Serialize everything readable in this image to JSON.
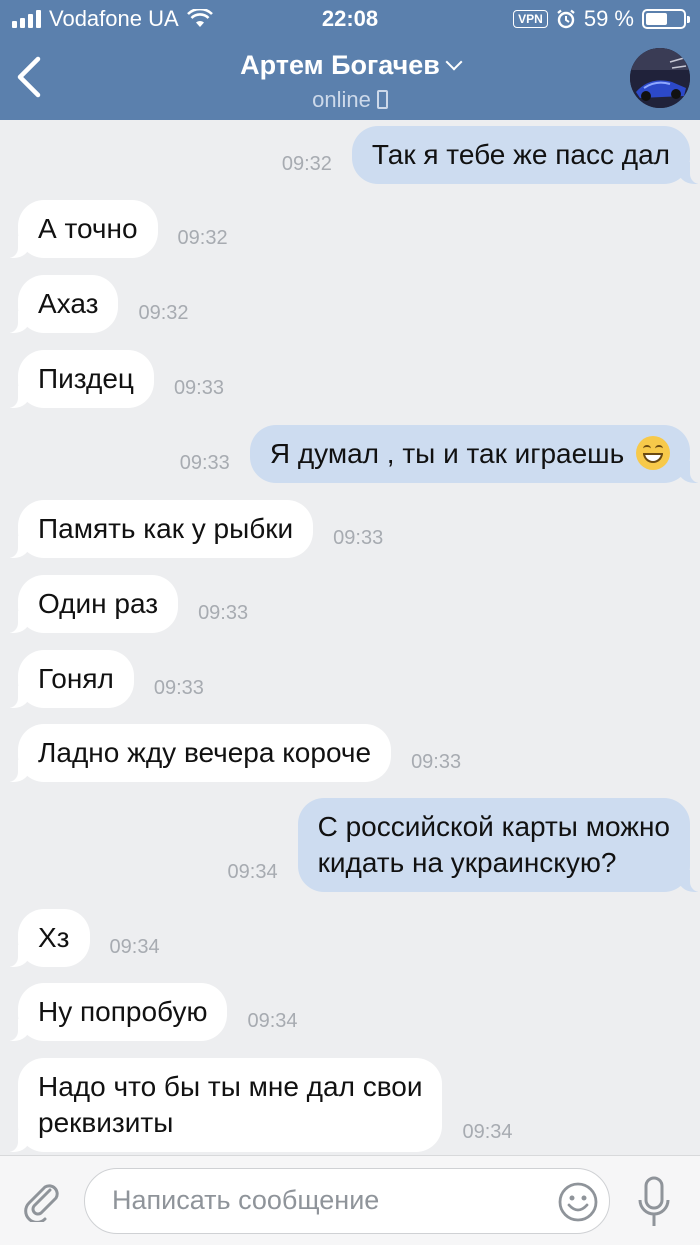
{
  "status_bar": {
    "carrier": "Vodafone UA",
    "time": "22:08",
    "vpn": "VPN",
    "battery_text": "59 %",
    "battery_level": 0.59
  },
  "header": {
    "title": "Артем Богачев",
    "subtitle": "online"
  },
  "messages": [
    {
      "dir": "out",
      "text": "Так я тебе же пасс дал",
      "time": "09:32"
    },
    {
      "dir": "in",
      "text": "А точно",
      "time": "09:32"
    },
    {
      "dir": "in",
      "text": "Ахаз",
      "time": "09:32"
    },
    {
      "dir": "in",
      "text": "Пиздец",
      "time": "09:33"
    },
    {
      "dir": "out",
      "text": "Я думал , ты и так играешь",
      "time": "09:33",
      "emoji": "grinning-face"
    },
    {
      "dir": "in",
      "text": "Память как у рыбки",
      "time": "09:33"
    },
    {
      "dir": "in",
      "text": "Один раз",
      "time": "09:33"
    },
    {
      "dir": "in",
      "text": "Гонял",
      "time": "09:33"
    },
    {
      "dir": "in",
      "text": "Ладно жду вечера короче",
      "time": "09:33"
    },
    {
      "dir": "out",
      "text": "С российской карты можно\nкидать на украинскую?",
      "time": "09:34"
    },
    {
      "dir": "in",
      "text": "Хз",
      "time": "09:34"
    },
    {
      "dir": "in",
      "text": "Ну попробую",
      "time": "09:34"
    },
    {
      "dir": "in",
      "text": "Надо что бы ты мне дал свои\nреквизиты",
      "time": "09:34"
    }
  ],
  "composer": {
    "placeholder": "Написать сообщение",
    "icons": [
      "attach-icon",
      "emoji-icon",
      "microphone-icon"
    ]
  },
  "colors": {
    "header": "#5b80ad",
    "outgoing_bubble": "#cddcf0",
    "incoming_bubble": "#ffffff",
    "background": "#edeef0"
  }
}
